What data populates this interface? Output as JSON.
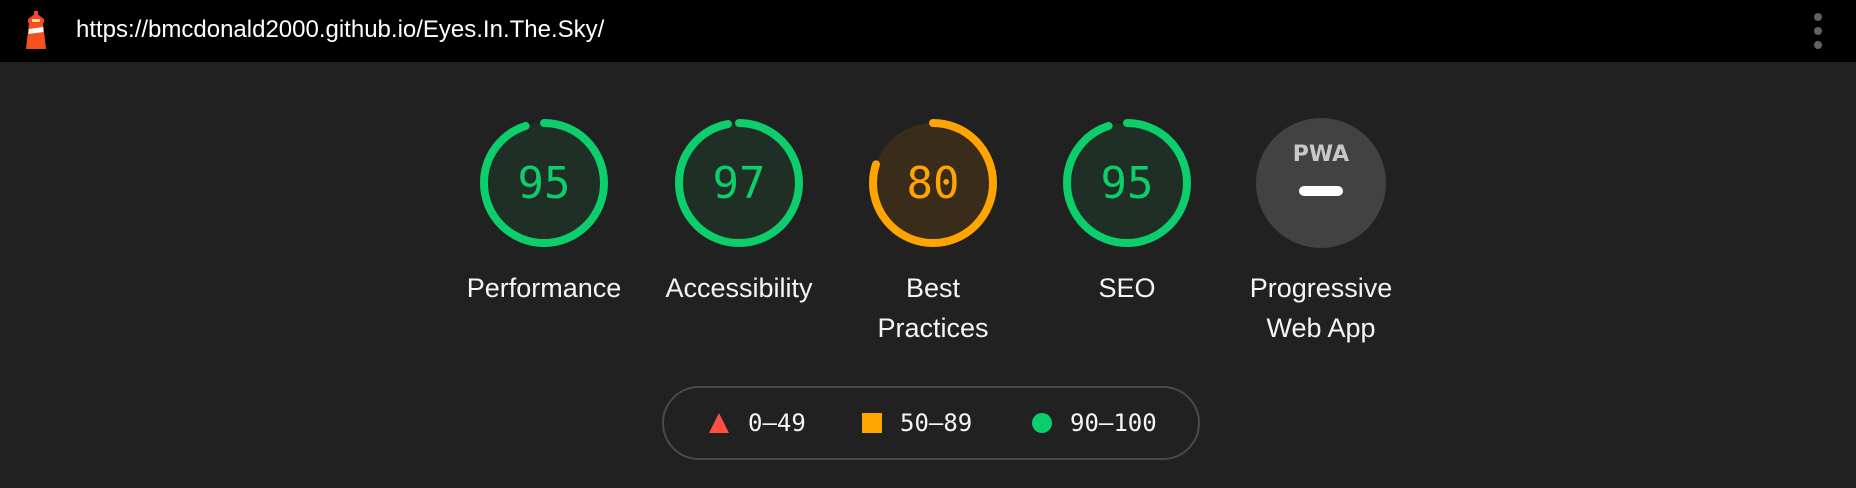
{
  "topbar": {
    "url": "https://bmcdonald2000.github.io/Eyes.In.The.Sky/",
    "logo_icon": "lighthouse-icon",
    "menu_icon": "kebab-menu-icon"
  },
  "gauges": [
    {
      "label": "Performance",
      "score": "95",
      "value": 95,
      "color": "#0cce6b",
      "fill": "#1f2f25"
    },
    {
      "label": "Accessibility",
      "score": "97",
      "value": 97,
      "color": "#0cce6b",
      "fill": "#1f2f25"
    },
    {
      "label": "Best Practices",
      "label_lines": [
        "Best",
        "Practices"
      ],
      "score": "80",
      "value": 80,
      "color": "#ffa400",
      "fill": "#3a2c1b"
    },
    {
      "label": "SEO",
      "score": "95",
      "value": 95,
      "color": "#0cce6b",
      "fill": "#1f2f25"
    },
    {
      "label": "Progressive Web App",
      "label_lines": [
        "Progressive",
        "Web App"
      ],
      "score": "PWA",
      "icon": "pwa-icon",
      "color": "#ffffff",
      "fill": "#424242"
    }
  ],
  "legend": {
    "items": [
      {
        "text": "0–49",
        "icon": "red-triangle-icon",
        "color": "#ff4e42"
      },
      {
        "text": "50–89",
        "icon": "orange-square-icon",
        "color": "#ffa400"
      },
      {
        "text": "90–100",
        "icon": "green-circle-icon",
        "color": "#0cce6b"
      }
    ]
  }
}
